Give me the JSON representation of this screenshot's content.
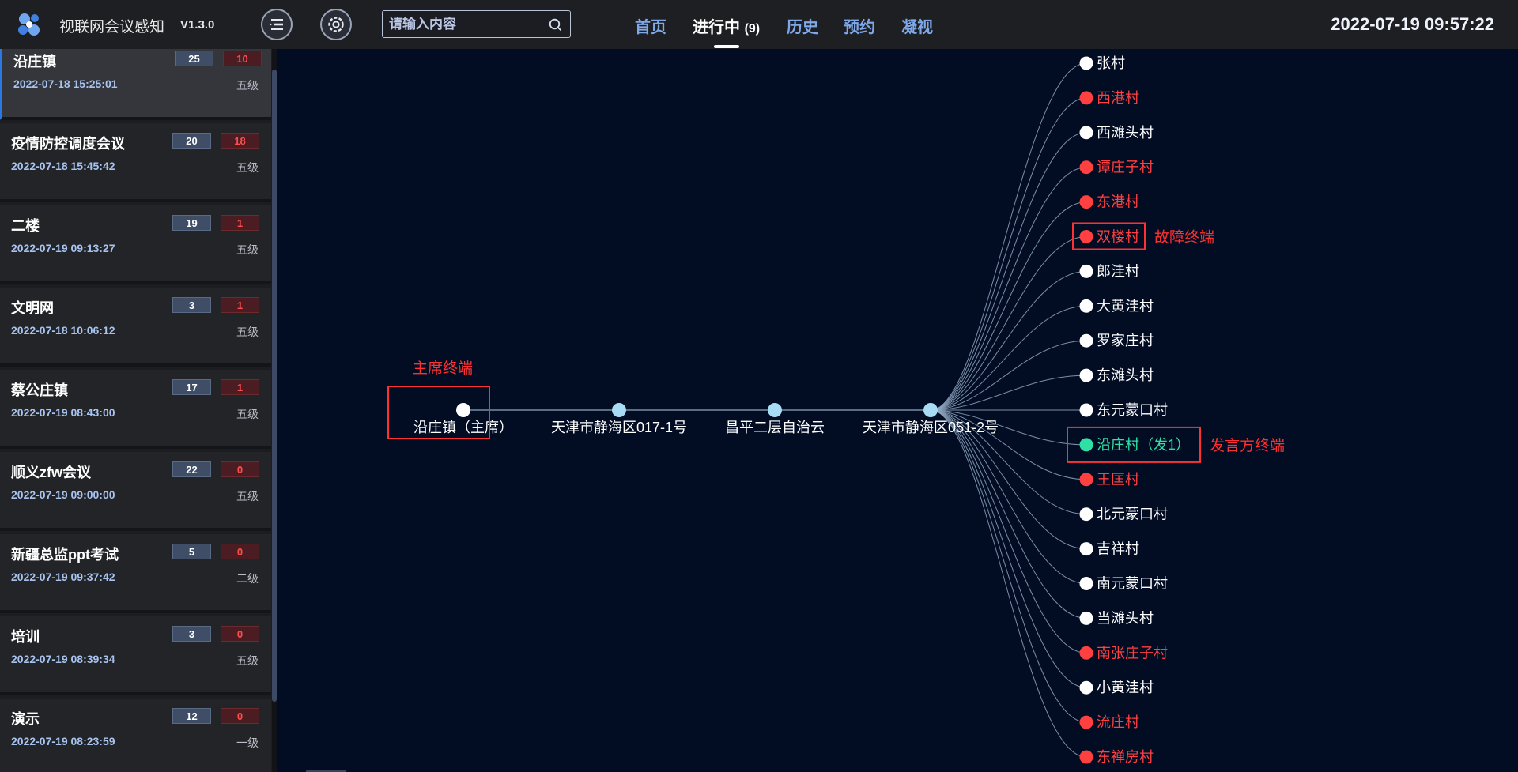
{
  "header": {
    "app_title": "视联网会议感知",
    "version": "V1.3.0",
    "search_placeholder": "请输入内容",
    "nav": [
      {
        "label": "首页",
        "count": ""
      },
      {
        "label": "进行中",
        "count": "(9)"
      },
      {
        "label": "历史",
        "count": ""
      },
      {
        "label": "预约",
        "count": ""
      },
      {
        "label": "凝视",
        "count": ""
      }
    ],
    "active_nav": "进行中",
    "datetime": "2022-07-19 09:57:22"
  },
  "meetings": [
    {
      "name": "沿庄镇",
      "total": "25",
      "faults": "10",
      "time": "2022-07-18 15:25:01",
      "level": "五级"
    },
    {
      "name": "疫情防控调度会议",
      "total": "20",
      "faults": "18",
      "time": "2022-07-18 15:45:42",
      "level": "五级"
    },
    {
      "name": "二楼",
      "total": "19",
      "faults": "1",
      "time": "2022-07-19 09:13:27",
      "level": "五级"
    },
    {
      "name": "文明网",
      "total": "3",
      "faults": "1",
      "time": "2022-07-18 10:06:12",
      "level": "五级"
    },
    {
      "name": "蔡公庄镇",
      "total": "17",
      "faults": "1",
      "time": "2022-07-19 08:43:00",
      "level": "五级"
    },
    {
      "name": "顺义zfw会议",
      "total": "22",
      "faults": "0",
      "time": "2022-07-19 09:00:00",
      "level": "五级"
    },
    {
      "name": "新疆总监ppt考试",
      "total": "5",
      "faults": "0",
      "time": "2022-07-19 09:37:42",
      "level": "二级"
    },
    {
      "name": "培训",
      "total": "3",
      "faults": "0",
      "time": "2022-07-19 08:39:34",
      "level": "五级"
    },
    {
      "name": "演示",
      "total": "12",
      "faults": "0",
      "time": "2022-07-19 08:23:59",
      "level": "一级"
    }
  ],
  "topology": {
    "chain": [
      {
        "label": "沿庄镇（主席）",
        "role": "chair"
      },
      {
        "label": "天津市静海区017-1号",
        "role": "relay"
      },
      {
        "label": "昌平二层自治云",
        "role": "relay"
      },
      {
        "label": "天津市静海区051-2号",
        "role": "relay"
      }
    ],
    "terminals": [
      {
        "label": "张村",
        "status": "normal"
      },
      {
        "label": "西港村",
        "status": "fault"
      },
      {
        "label": "西滩头村",
        "status": "normal"
      },
      {
        "label": "谭庄子村",
        "status": "fault"
      },
      {
        "label": "东港村",
        "status": "fault"
      },
      {
        "label": "双楼村",
        "status": "fault"
      },
      {
        "label": "郎洼村",
        "status": "normal"
      },
      {
        "label": "大黄洼村",
        "status": "normal"
      },
      {
        "label": "罗家庄村",
        "status": "normal"
      },
      {
        "label": "东滩头村",
        "status": "normal"
      },
      {
        "label": "东元蒙口村",
        "status": "normal"
      },
      {
        "label": "沿庄村（发1）",
        "status": "speaker"
      },
      {
        "label": "王匡村",
        "status": "fault"
      },
      {
        "label": "北元蒙口村",
        "status": "normal"
      },
      {
        "label": "吉祥村",
        "status": "normal"
      },
      {
        "label": "南元蒙口村",
        "status": "normal"
      },
      {
        "label": "当滩头村",
        "status": "normal"
      },
      {
        "label": "南张庄子村",
        "status": "fault"
      },
      {
        "label": "小黄洼村",
        "status": "normal"
      },
      {
        "label": "流庄村",
        "status": "fault"
      },
      {
        "label": "东禅房村",
        "status": "fault"
      }
    ],
    "annotations": {
      "chair": "主席终端",
      "fault": "故障终端",
      "speaker": "发言方终端"
    },
    "colors": {
      "normal": "#ffffff",
      "fault": "#ff4040",
      "speaker": "#2fe0a5",
      "relay": "#a8dcf5",
      "annotation": "#ff3030",
      "link": "#8fa6c0"
    }
  }
}
